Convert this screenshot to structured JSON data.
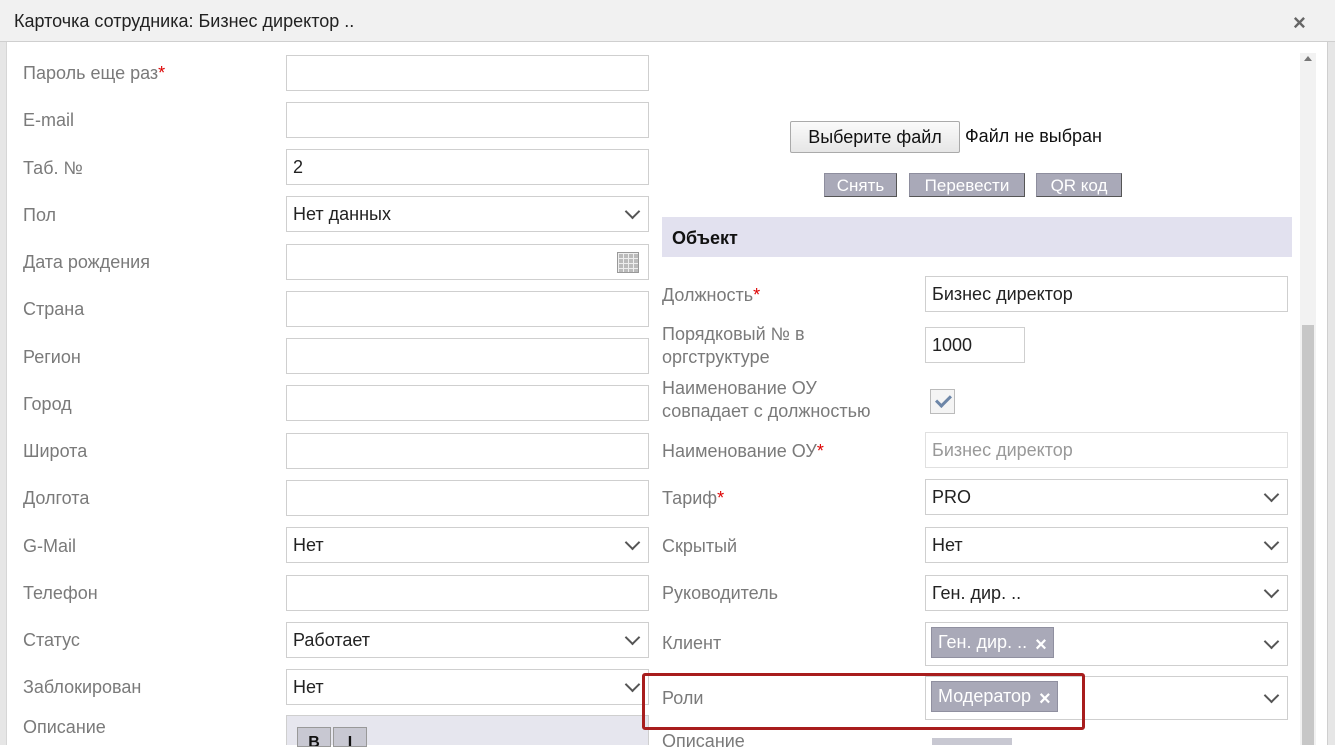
{
  "window": {
    "title": "Карточка сотрудника: Бизнес директор ..",
    "close_label": "×"
  },
  "left_form": [
    {
      "label": "Пароль еще раз",
      "required": true,
      "type": "text",
      "value": ""
    },
    {
      "label": "E-mail",
      "required": false,
      "type": "text",
      "value": ""
    },
    {
      "label": "Таб. №",
      "required": false,
      "type": "text",
      "value": "2"
    },
    {
      "label": "Пол",
      "required": false,
      "type": "select",
      "value": "Нет данных"
    },
    {
      "label": "Дата рождения",
      "required": false,
      "type": "date",
      "value": ""
    },
    {
      "label": "Страна",
      "required": false,
      "type": "text",
      "value": ""
    },
    {
      "label": "Регион",
      "required": false,
      "type": "text",
      "value": ""
    },
    {
      "label": "Город",
      "required": false,
      "type": "text",
      "value": ""
    },
    {
      "label": "Широта",
      "required": false,
      "type": "text",
      "value": ""
    },
    {
      "label": "Долгота",
      "required": false,
      "type": "text",
      "value": ""
    },
    {
      "label": "G-Mail",
      "required": false,
      "type": "select",
      "value": "Нет"
    },
    {
      "label": "Телефон",
      "required": false,
      "type": "text",
      "value": ""
    },
    {
      "label": "Статус",
      "required": false,
      "type": "select",
      "value": "Работает"
    },
    {
      "label": "Заблокирован",
      "required": false,
      "type": "select",
      "value": "Нет"
    },
    {
      "label": "Описание",
      "required": false,
      "type": "editor",
      "value": ""
    }
  ],
  "photo": {
    "choose_file_label": "Выберите файл",
    "no_file_text": "Файл не выбран",
    "buttons": [
      "Снять",
      "Перевести",
      "QR код"
    ]
  },
  "section_title": "Объект",
  "right_form": [
    {
      "label": "Должность",
      "required": true,
      "type": "text",
      "value": "Бизнес директор"
    },
    {
      "label": "Порядковый № в\nоргструктуре",
      "required": false,
      "type": "text",
      "value": "1000"
    },
    {
      "label": "Наименование ОУ\nсовпадает с должностью",
      "required": false,
      "type": "checkbox",
      "checked": true
    },
    {
      "label": "Наименование ОУ",
      "required": true,
      "type": "text",
      "value": "Бизнес директор",
      "disabled": true
    },
    {
      "label": "Тариф",
      "required": true,
      "type": "select",
      "value": "PRO"
    },
    {
      "label": "Скрытый",
      "required": false,
      "type": "select",
      "value": "Нет"
    },
    {
      "label": "Руководитель",
      "required": false,
      "type": "select",
      "value": "Ген. дир. .."
    },
    {
      "label": "Клиент",
      "required": false,
      "type": "multiselect",
      "tags": [
        "Ген. дир. .."
      ]
    },
    {
      "label": "Роли",
      "required": false,
      "type": "multiselect",
      "tags": [
        "Модератор"
      ],
      "highlighted": true
    },
    {
      "label": "Описание",
      "required": false,
      "type": "editor",
      "value": ""
    }
  ],
  "req_mark": "*",
  "tag_remove": "×",
  "editor_buttons": [
    "B",
    "I"
  ],
  "colors": {
    "highlight": "#a81d1d",
    "section_bg": "#e2e1ef",
    "tag_bg": "#a9a9b8",
    "required": "#dd0000"
  }
}
